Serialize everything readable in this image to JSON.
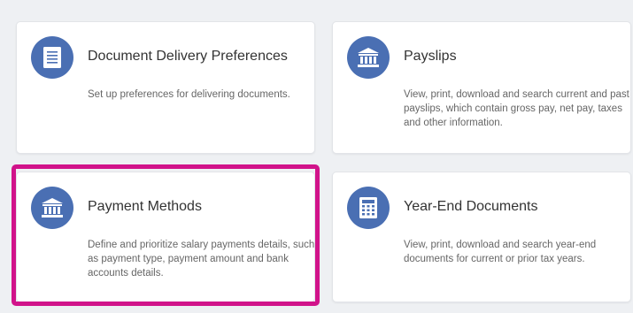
{
  "cards": [
    {
      "title": "Document Delivery Preferences",
      "description": "Set up preferences for delivering documents.",
      "icon": "document-icon"
    },
    {
      "title": "Payslips",
      "description": "View, print, download and search current and past payslips, which contain gross pay, net pay, taxes and other information.",
      "icon": "bank-icon"
    },
    {
      "title": "Payment Methods",
      "description": "Define and prioritize salary payments details, such as payment type, payment amount and bank accounts details.",
      "icon": "bank-icon",
      "highlighted": true
    },
    {
      "title": "Year-End Documents",
      "description": "View, print, download and search year-end documents for current or prior tax years.",
      "icon": "ledger-icon"
    }
  ],
  "colors": {
    "icon_bg": "#4a6fb3",
    "highlight": "#d1138a",
    "page_bg": "#eef0f3"
  }
}
